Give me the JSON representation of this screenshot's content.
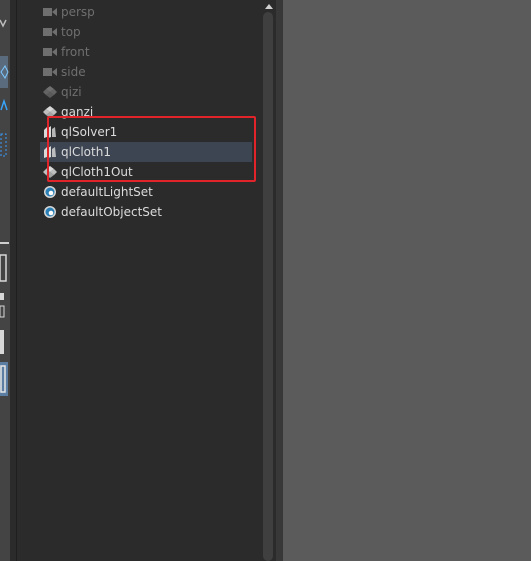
{
  "outliner": {
    "items": [
      {
        "label": "persp",
        "icon": "camera-icon",
        "dim": true
      },
      {
        "label": "top",
        "icon": "camera-icon",
        "dim": true
      },
      {
        "label": "front",
        "icon": "camera-icon",
        "dim": true
      },
      {
        "label": "side",
        "icon": "camera-icon",
        "dim": true
      },
      {
        "label": "qizi",
        "icon": "mesh-transform-icon",
        "dim": true
      },
      {
        "label": "ganzi",
        "icon": "mesh-transform-icon",
        "dim": false
      },
      {
        "label": "qlSolver1",
        "icon": "qlsolver-icon",
        "dim": false
      },
      {
        "label": "qlCloth1",
        "icon": "qlsolver-icon",
        "dim": false,
        "selected": true
      },
      {
        "label": "qlCloth1Out",
        "icon": "mesh-transform-icon",
        "dim": false
      },
      {
        "label": "defaultLightSet",
        "icon": "set-icon",
        "dim": false
      },
      {
        "label": "defaultObjectSet",
        "icon": "set-icon",
        "dim": false
      }
    ]
  },
  "colors": {
    "highlight_box": "#e0242a",
    "selection": "#3d4553",
    "toolbar_accent": "#5a9bd5"
  }
}
